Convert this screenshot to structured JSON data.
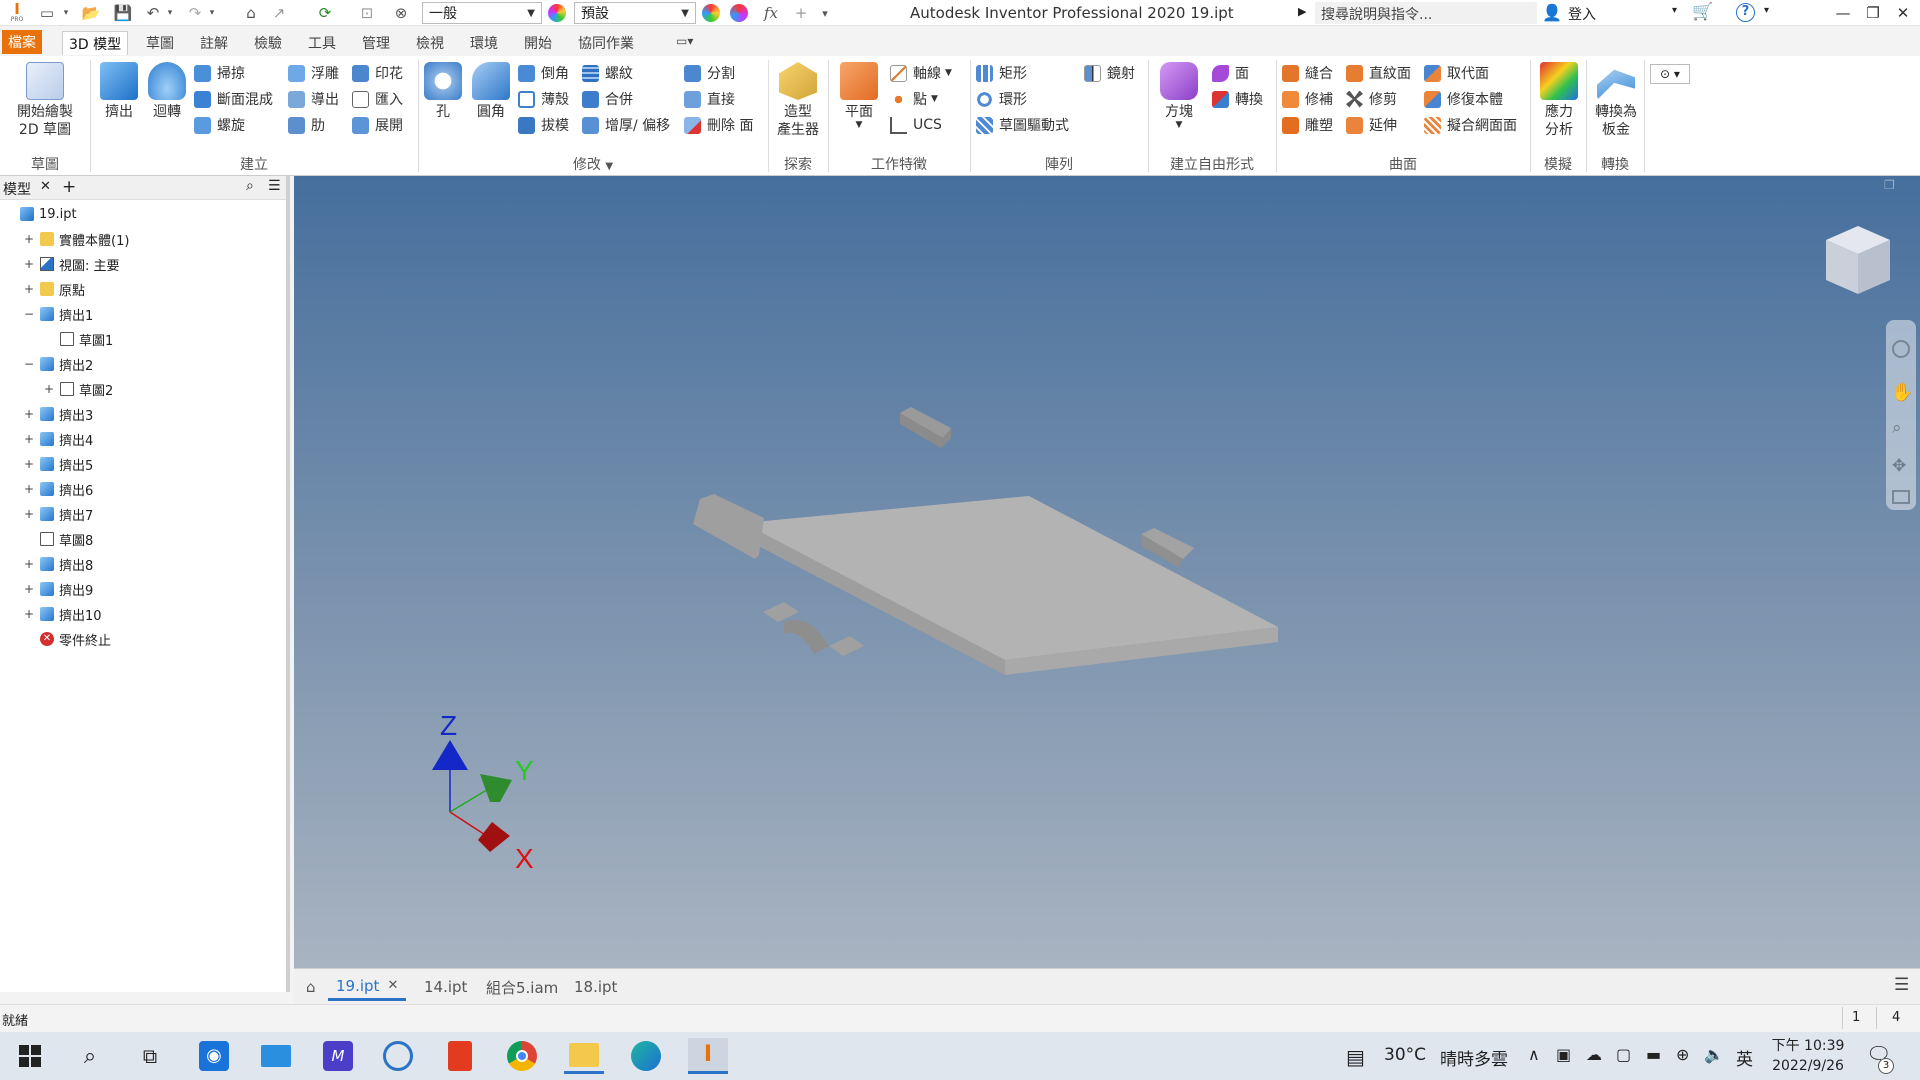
{
  "titlebar": {
    "app_logo": "I",
    "app_logo_sub": "PRO",
    "material_value": "一般",
    "appearance_value": "預設",
    "title": "Autodesk Inventor Professional 2020    19.ipt",
    "search_placeholder": "搜尋說明與指令...",
    "signin_label": "登入"
  },
  "ribbon_tabs": [
    "檔案",
    "3D 模型",
    "草圖",
    "註解",
    "檢驗",
    "工具",
    "管理",
    "檢視",
    "環境",
    "開始",
    "協同作業"
  ],
  "ribbon": {
    "groups": {
      "sketch": "草圖",
      "create": "建立",
      "modify": "修改",
      "explore": "探索",
      "work_features": "工作特徵",
      "pattern": "陣列",
      "freeform": "建立自由形式",
      "surface": "曲面",
      "simulation": "模擬",
      "convert": "轉換"
    },
    "start_2d_sketch": [
      "開始繪製",
      "2D 草圖"
    ],
    "extrude": "擠出",
    "revolve": "迴轉",
    "sweep": "掃掠",
    "loft": "斷面混成",
    "coil": "螺旋",
    "emboss": "浮雕",
    "derive": "導出",
    "rib": "肋",
    "decal": "印花",
    "import": "匯入",
    "unwrap": "展開",
    "hole": "孔",
    "fillet": "圓角",
    "chamfer": "倒角",
    "shell": "薄殼",
    "draft": "拔模",
    "thread": "螺紋",
    "combine": "合併",
    "thicken": "增厚/ 偏移",
    "split": "分割",
    "direct": "直接",
    "delete_face": "刪除 面",
    "shape_generator": [
      "造型",
      "產生器"
    ],
    "plane": "平面",
    "axis": "軸線",
    "point": "點",
    "ucs": "UCS",
    "rectangular": "矩形",
    "circular": "環形",
    "sketch_driven": "草圖驅動式",
    "mirror": "鏡射",
    "box": "方塊",
    "face": "面",
    "convert_ff": "轉換",
    "stitch": "縫合",
    "patch": "修補",
    "sculpt": "雕塑",
    "ruled_surface": "直紋面",
    "trim": "修剪",
    "extend": "延伸",
    "replace_face": "取代面",
    "repair_bodies": "修復本體",
    "fit_mesh_face": "擬合網面面",
    "stress_analysis": [
      "應力",
      "分析"
    ],
    "convert_sheet_metal": [
      "轉換為",
      "板金"
    ]
  },
  "browser": {
    "tab_label": "模型",
    "add_label": "+",
    "items": [
      {
        "label": "19.ipt",
        "toggle": "",
        "icon": "part",
        "indent": 0
      },
      {
        "label": "實體本體(1)",
        "toggle": "+",
        "icon": "folder",
        "indent": 1
      },
      {
        "label": "視圖: 主要",
        "toggle": "+",
        "icon": "view",
        "indent": 1
      },
      {
        "label": "原點",
        "toggle": "+",
        "icon": "folder",
        "indent": 1
      },
      {
        "label": "擠出1",
        "toggle": "−",
        "icon": "extrude",
        "indent": 1
      },
      {
        "label": "草圖1",
        "toggle": "",
        "icon": "sketch",
        "indent": 2
      },
      {
        "label": "擠出2",
        "toggle": "−",
        "icon": "extrude",
        "indent": 1
      },
      {
        "label": "草圖2",
        "toggle": "+",
        "icon": "sketch",
        "indent": 2
      },
      {
        "label": "擠出3",
        "toggle": "+",
        "icon": "extrude",
        "indent": 1
      },
      {
        "label": "擠出4",
        "toggle": "+",
        "icon": "extrude",
        "indent": 1
      },
      {
        "label": "擠出5",
        "toggle": "+",
        "icon": "extrude",
        "indent": 1
      },
      {
        "label": "擠出6",
        "toggle": "+",
        "icon": "extrude",
        "indent": 1
      },
      {
        "label": "擠出7",
        "toggle": "+",
        "icon": "extrude",
        "indent": 1
      },
      {
        "label": "草圖8",
        "toggle": "",
        "icon": "sketch",
        "indent": 1
      },
      {
        "label": "擠出8",
        "toggle": "+",
        "icon": "extrude",
        "indent": 1
      },
      {
        "label": "擠出9",
        "toggle": "+",
        "icon": "extrude",
        "indent": 1
      },
      {
        "label": "擠出10",
        "toggle": "+",
        "icon": "extrude",
        "indent": 1
      },
      {
        "label": "零件終止",
        "toggle": "",
        "icon": "end",
        "indent": 1
      }
    ]
  },
  "viewport": {
    "triad_z": "Z",
    "triad_y": "Y",
    "triad_x": "X"
  },
  "doc_tabs": [
    "19.ipt",
    "14.ipt",
    "組合5.iam",
    "18.ipt"
  ],
  "status": {
    "text": "就緒",
    "count1": "1",
    "count2": "4"
  },
  "taskbar": {
    "weather_temp": "30°C",
    "weather_text": "晴時多雲",
    "ime": "英",
    "time": "下午 10:39",
    "date": "2022/9/26",
    "notif_count": "3"
  },
  "colors": {
    "file_tab": "#e8710a",
    "accent_blue": "#2a73c6",
    "axis_x": "#cc1111",
    "axis_y": "#22aa22",
    "axis_z": "#1428c8",
    "error_red": "#d32f2f"
  }
}
